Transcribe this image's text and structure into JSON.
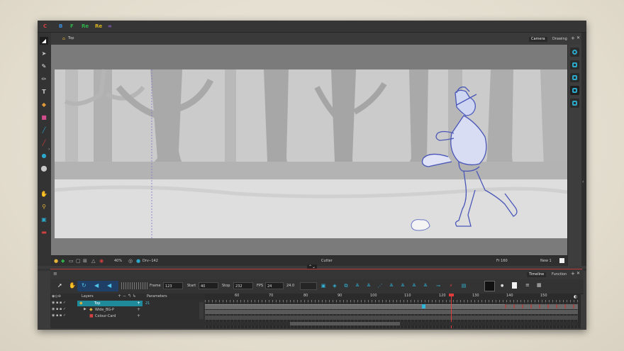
{
  "colors": {
    "accent": "#2aa7c9",
    "playhead": "#e23b3b",
    "layer_selected": "#1f8a9a",
    "sketch": "#4a57b8"
  },
  "topbar": {
    "items": [
      {
        "label": "C",
        "color": "#d34040",
        "icon": "recycle-icon"
      },
      {
        "label": "B",
        "color": "#3a8ee0",
        "icon": "letter-b-icon"
      },
      {
        "label": "F",
        "color": "#2fb34a",
        "icon": "letter-f-icon"
      },
      {
        "label": "Re",
        "color": "#2fb34a",
        "icon": "rewind-icon"
      },
      {
        "label": "Re",
        "color": "#d8b222",
        "icon": "reset-icon"
      },
      {
        "label": "∞",
        "color": "#8e5fd0",
        "icon": "loop-icon"
      }
    ]
  },
  "view": {
    "title": "Top",
    "tabs": [
      "Camera",
      "Drawing"
    ],
    "zoom": "40%",
    "rotation": "Drv--142",
    "tool_name": "Cutter",
    "frame_readout": "Fr 160",
    "new_label": "New 1"
  },
  "tools": [
    "select-tool-icon",
    "contour-icon",
    "brush-icon",
    "pencil-icon",
    "text-icon",
    "paint-icon",
    "eraser-icon",
    "line-icon",
    "stroke-icon",
    "dropper-icon",
    "shape-icon",
    "hand-icon",
    "zoom-icon",
    "crop-icon",
    "camera-icon"
  ],
  "timeline": {
    "tabs": [
      "Timeline",
      "Function"
    ],
    "frame_label": "Frame",
    "frame_value": "123",
    "start_label": "Start",
    "start_value": "40",
    "stop_label": "Stop",
    "stop_value": "232",
    "fps_label": "FPS",
    "fps_value": "24",
    "fps_display": "24.0",
    "columns": {
      "layers": "Layers",
      "parameters": "Parameters"
    },
    "layers": [
      {
        "name": "Top",
        "value": "21",
        "selected": true
      },
      {
        "name": "Wide_BG-P",
        "value": "",
        "selected": false
      },
      {
        "name": "Colour-Card",
        "value": "",
        "selected": false
      }
    ],
    "ruler": [
      "60",
      "70",
      "80",
      "90",
      "100",
      "110",
      "120",
      "130",
      "140",
      "150"
    ],
    "current_frame": 123
  }
}
